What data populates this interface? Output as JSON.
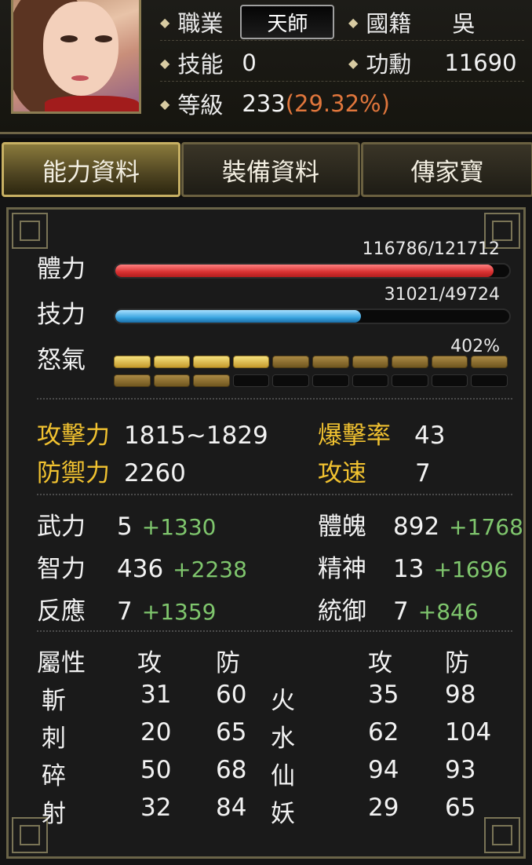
{
  "header": {
    "job": {
      "label": "職業",
      "value": "天師"
    },
    "nation": {
      "label": "國籍",
      "value": "吳"
    },
    "skill": {
      "label": "技能",
      "value": "0"
    },
    "merit": {
      "label": "功勳",
      "value": "11690"
    },
    "level": {
      "label": "等級",
      "value": "233",
      "percent": "(29.32%)"
    }
  },
  "tabs": [
    {
      "label": "能力資料",
      "active": true
    },
    {
      "label": "裝備資料",
      "active": false
    },
    {
      "label": "傳家寶",
      "active": false
    }
  ],
  "bars": {
    "hp": {
      "label": "體力",
      "text": "116786/121712",
      "current": 116786,
      "max": 121712
    },
    "mp": {
      "label": "技力",
      "text": "31021/49724",
      "current": 31021,
      "max": 49724
    },
    "rage": {
      "label": "怒氣",
      "text": "402%",
      "full_segments": 7,
      "dim_segments": 6,
      "total_segments": 20
    }
  },
  "combat": {
    "attack": {
      "label": "攻擊力",
      "value": "1815~1829"
    },
    "crit": {
      "label": "爆擊率",
      "value": "43"
    },
    "defense": {
      "label": "防禦力",
      "value": "2260"
    },
    "speed": {
      "label": "攻速",
      "value": "7"
    }
  },
  "stats": {
    "str": {
      "label": "武力",
      "base": "5",
      "bonus": "+1330"
    },
    "vit": {
      "label": "體魄",
      "base": "892",
      "bonus": "+1768"
    },
    "int": {
      "label": "智力",
      "base": "436",
      "bonus": "+2238"
    },
    "spi": {
      "label": "精神",
      "base": "13",
      "bonus": "+1696"
    },
    "agi": {
      "label": "反應",
      "base": "7",
      "bonus": "+1359"
    },
    "lead": {
      "label": "統御",
      "base": "7",
      "bonus": "+846"
    }
  },
  "attributes": {
    "title": "屬性",
    "atk_header": "攻",
    "def_header": "防",
    "left": [
      {
        "name": "斬",
        "atk": "31",
        "def": "60"
      },
      {
        "name": "刺",
        "atk": "20",
        "def": "65"
      },
      {
        "name": "碎",
        "atk": "50",
        "def": "68"
      },
      {
        "name": "射",
        "atk": "32",
        "def": "84"
      }
    ],
    "right": [
      {
        "name": "火",
        "atk": "35",
        "def": "98"
      },
      {
        "name": "水",
        "atk": "62",
        "def": "104"
      },
      {
        "name": "仙",
        "atk": "94",
        "def": "93"
      },
      {
        "name": "妖",
        "atk": "29",
        "def": "65"
      }
    ]
  },
  "colors": {
    "gold": "#f1c230",
    "green": "#7fc66d",
    "orange": "#e0763c",
    "hp": "#d83030",
    "mp": "#3ba5e0"
  }
}
